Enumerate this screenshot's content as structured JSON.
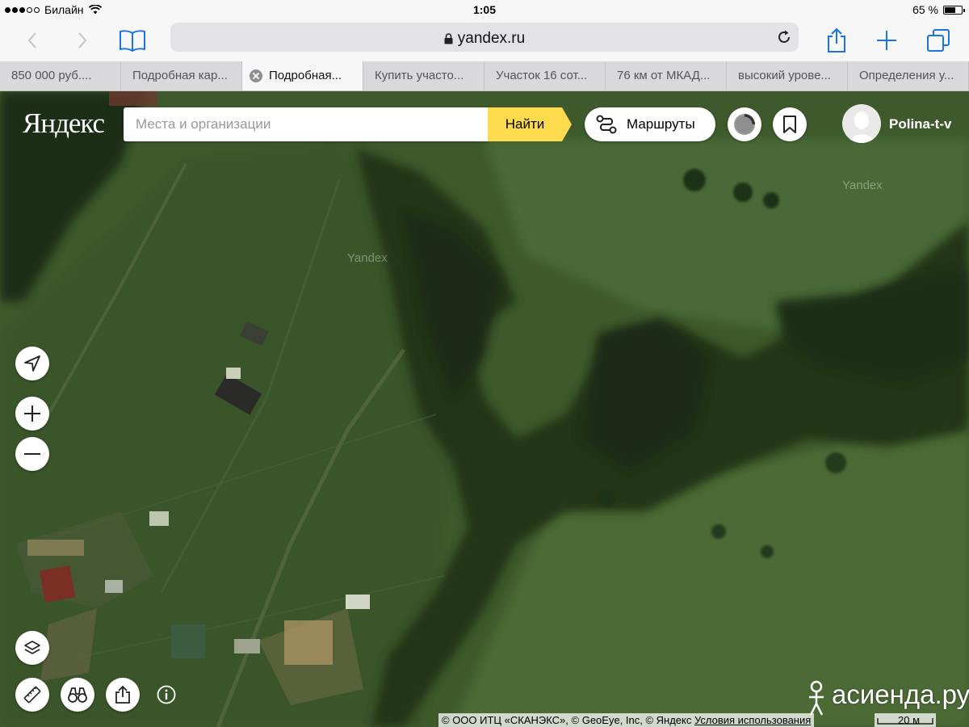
{
  "status_bar": {
    "carrier": "Билайн",
    "time": "1:05",
    "battery_text": "65 %",
    "battery_level": 0.65
  },
  "browser": {
    "url": "yandex.ru",
    "tabs": [
      {
        "label": "850 000 руб....",
        "active": false
      },
      {
        "label": "Подробная кар...",
        "active": false
      },
      {
        "label": "Подробная...",
        "active": true
      },
      {
        "label": "Купить участо...",
        "active": false
      },
      {
        "label": "Участок 16 сот...",
        "active": false
      },
      {
        "label": "76 км от МКАД...",
        "active": false
      },
      {
        "label": "высокий урове...",
        "active": false
      },
      {
        "label": "Определения у...",
        "active": false
      }
    ]
  },
  "map": {
    "logo": "Яндекс",
    "search_placeholder": "Места и организации",
    "search_button": "Найти",
    "routes_button": "Маршруты",
    "username": "Polina-t-v",
    "watermark": "Yandex",
    "copyright": "© ООО ИТЦ «СКАНЭКС», © GeoEye, Inc, © Яндекс",
    "terms_link": "Условия использования",
    "scale_label": "20 м",
    "site_watermark": "асиенда.ру",
    "icons": [
      "location-arrow-icon",
      "plus-icon",
      "minus-icon",
      "layers-icon",
      "ruler-icon",
      "binoculars-icon",
      "share-icon",
      "info-icon",
      "traffic-icon",
      "bookmark-icon",
      "route-icon"
    ],
    "colors": {
      "search_button": "#ffdb4d"
    }
  }
}
